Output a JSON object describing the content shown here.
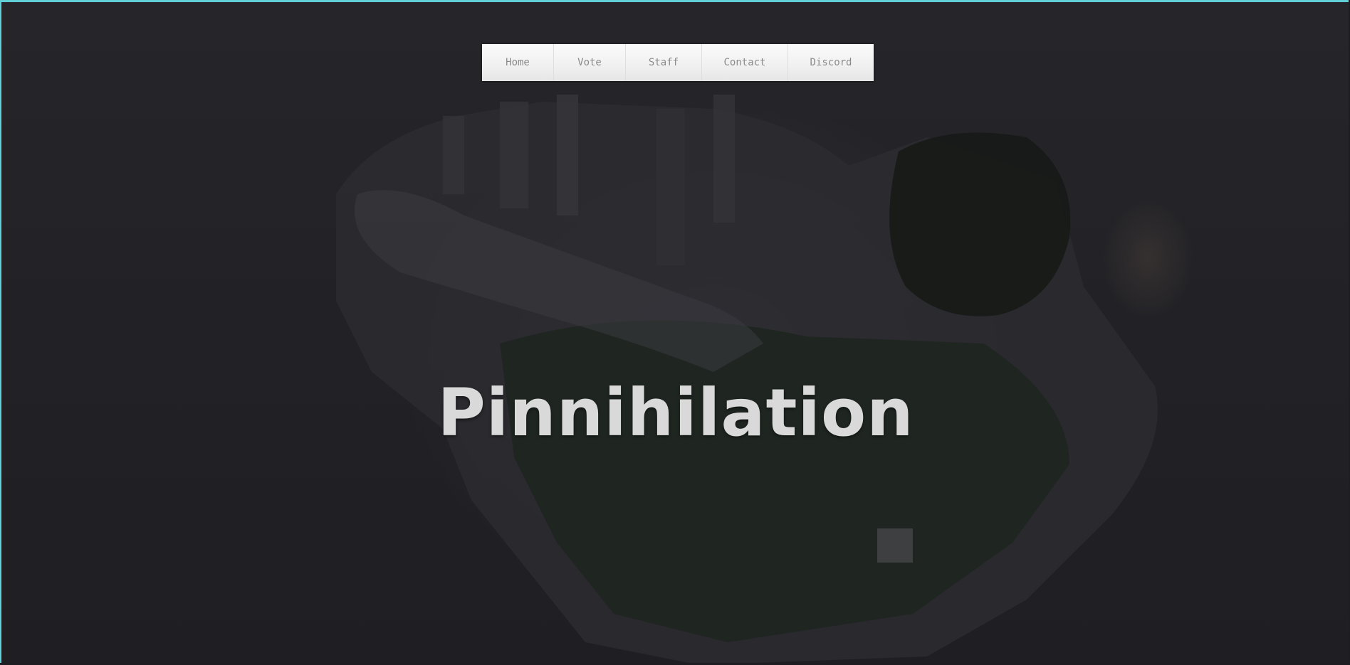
{
  "nav": {
    "items": [
      {
        "label": "Home"
      },
      {
        "label": "Vote"
      },
      {
        "label": "Staff"
      },
      {
        "label": "Contact"
      },
      {
        "label": "Discord"
      }
    ]
  },
  "hero": {
    "title": "Pinnihilation"
  },
  "colors": {
    "frame_accent": "#5fd0d8",
    "background": "#222226",
    "nav_background": "#f1f1f1",
    "nav_text": "#8a8a8a",
    "title_text": "#d9d9d9"
  }
}
